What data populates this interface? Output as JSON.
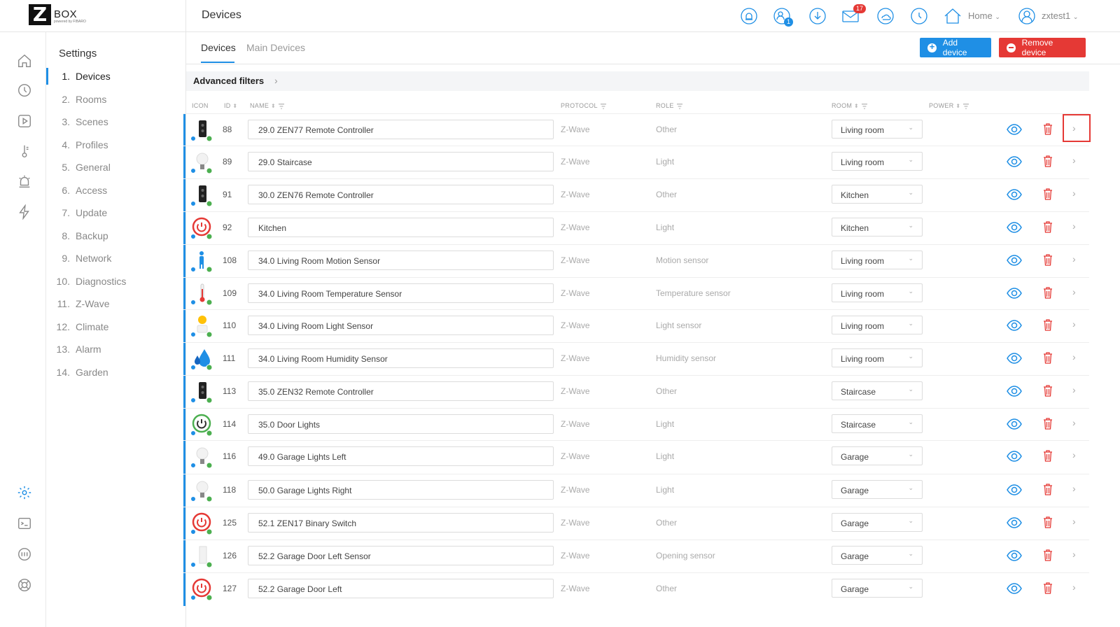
{
  "logo": {
    "letter": "Z",
    "text": "BOX",
    "sub": "powered by FIBARO"
  },
  "header": {
    "title": "Devices",
    "home_label": "Home",
    "user_label": "zxtest1",
    "mail_badge": "17",
    "users_badge": "1"
  },
  "menu": {
    "title": "Settings",
    "items": [
      {
        "num": "1.",
        "label": "Devices"
      },
      {
        "num": "2.",
        "label": "Rooms"
      },
      {
        "num": "3.",
        "label": "Scenes"
      },
      {
        "num": "4.",
        "label": "Profiles"
      },
      {
        "num": "5.",
        "label": "General"
      },
      {
        "num": "6.",
        "label": "Access"
      },
      {
        "num": "7.",
        "label": "Update"
      },
      {
        "num": "8.",
        "label": "Backup"
      },
      {
        "num": "9.",
        "label": "Network"
      },
      {
        "num": "10.",
        "label": "Diagnostics"
      },
      {
        "num": "11.",
        "label": "Z-Wave"
      },
      {
        "num": "12.",
        "label": "Climate"
      },
      {
        "num": "13.",
        "label": "Alarm"
      },
      {
        "num": "14.",
        "label": "Garden"
      }
    ]
  },
  "tabs": {
    "devices": "Devices",
    "main_devices": "Main Devices"
  },
  "buttons": {
    "add": "Add device",
    "remove": "Remove device"
  },
  "filters": {
    "label": "Advanced filters"
  },
  "table": {
    "columns": {
      "icon": "ICON",
      "id": "ID",
      "name": "NAME",
      "protocol": "PROTOCOL",
      "role": "ROLE",
      "room": "ROOM",
      "power": "POWER"
    },
    "rows": [
      {
        "icon": "remote",
        "id": "88",
        "name": "29.0 ZEN77 Remote Controller",
        "protocol": "Z-Wave",
        "role": "Other",
        "room": "Living room"
      },
      {
        "icon": "bulb",
        "id": "89",
        "name": "29.0 Staircase",
        "protocol": "Z-Wave",
        "role": "Light",
        "room": "Living room"
      },
      {
        "icon": "remote",
        "id": "91",
        "name": "30.0 ZEN76 Remote Controller",
        "protocol": "Z-Wave",
        "role": "Other",
        "room": "Kitchen"
      },
      {
        "icon": "power-red",
        "id": "92",
        "name": "Kitchen",
        "protocol": "Z-Wave",
        "role": "Light",
        "room": "Kitchen"
      },
      {
        "icon": "motion",
        "id": "108",
        "name": "34.0 Living Room Motion Sensor",
        "protocol": "Z-Wave",
        "role": "Motion sensor",
        "room": "Living room"
      },
      {
        "icon": "thermo",
        "id": "109",
        "name": "34.0 Living Room Temperature Sensor",
        "protocol": "Z-Wave",
        "role": "Temperature sensor",
        "room": "Living room"
      },
      {
        "icon": "light-sensor",
        "id": "110",
        "name": "34.0 Living Room Light Sensor",
        "protocol": "Z-Wave",
        "role": "Light sensor",
        "room": "Living room"
      },
      {
        "icon": "humidity",
        "id": "111",
        "name": "34.0 Living Room Humidity Sensor",
        "protocol": "Z-Wave",
        "role": "Humidity sensor",
        "room": "Living room"
      },
      {
        "icon": "remote",
        "id": "113",
        "name": "35.0 ZEN32 Remote Controller",
        "protocol": "Z-Wave",
        "role": "Other",
        "room": "Staircase"
      },
      {
        "icon": "power-green",
        "id": "114",
        "name": "35.0 Door Lights",
        "protocol": "Z-Wave",
        "role": "Light",
        "room": "Staircase"
      },
      {
        "icon": "bulb",
        "id": "116",
        "name": "49.0 Garage Lights Left",
        "protocol": "Z-Wave",
        "role": "Light",
        "room": "Garage"
      },
      {
        "icon": "bulb",
        "id": "118",
        "name": "50.0 Garage Lights Right",
        "protocol": "Z-Wave",
        "role": "Light",
        "room": "Garage"
      },
      {
        "icon": "power-red",
        "id": "125",
        "name": "52.1 ZEN17 Binary Switch",
        "protocol": "Z-Wave",
        "role": "Other",
        "room": "Garage"
      },
      {
        "icon": "door",
        "id": "126",
        "name": "52.2 Garage Door Left Sensor",
        "protocol": "Z-Wave",
        "role": "Opening sensor",
        "room": "Garage"
      },
      {
        "icon": "power-red",
        "id": "127",
        "name": "52.2 Garage Door Left",
        "protocol": "Z-Wave",
        "role": "Other",
        "room": "Garage"
      }
    ]
  },
  "colors": {
    "accent": "#1f8fe5",
    "danger": "#e53935",
    "status_ok": "#4caf50"
  }
}
